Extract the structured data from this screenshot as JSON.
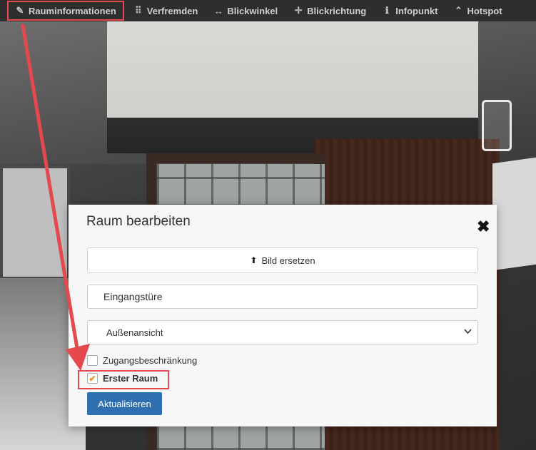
{
  "toolbar": {
    "items": [
      {
        "label": "Rauminformationen",
        "icon": "pencil-icon",
        "glyph": "✎",
        "active": true
      },
      {
        "label": "Verfremden",
        "icon": "grid-dots-icon",
        "glyph": "⠿",
        "active": false
      },
      {
        "label": "Blickwinkel",
        "icon": "horizontal-resize-icon",
        "glyph": "↔",
        "active": false
      },
      {
        "label": "Blickrichtung",
        "icon": "move-arrows-icon",
        "glyph": "✛",
        "active": false
      },
      {
        "label": "Infopunkt",
        "icon": "info-icon",
        "glyph": "ℹ",
        "active": false
      },
      {
        "label": "Hotspot",
        "icon": "chevron-up-circle-icon",
        "glyph": "⌃",
        "active": false
      }
    ]
  },
  "modal": {
    "title": "Raum bearbeiten",
    "close_glyph": "✖",
    "replace_image_label": "Bild ersetzen",
    "replace_icon_glyph": "⬆",
    "name_value": "Eingangstüre",
    "category_selected": "Außenansicht",
    "checkbox_access": {
      "label": "Zugangsbeschränkung",
      "checked": false
    },
    "checkbox_first_room": {
      "label": "Erster Raum",
      "checked": true,
      "glyph": "✔"
    },
    "update_label": "Aktualisieren"
  },
  "colors": {
    "annotation_red": "#e5484d",
    "primary_button": "#2f6fb0",
    "check_orange": "#f08c1c"
  }
}
